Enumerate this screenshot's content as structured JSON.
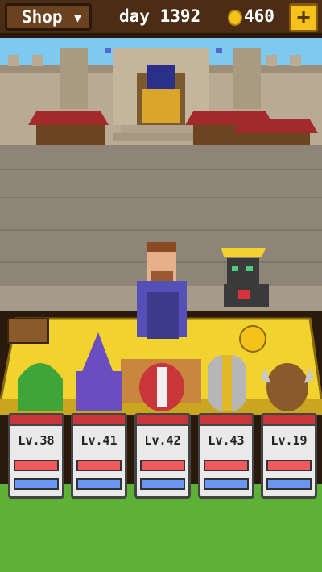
{
  "topbar": {
    "shop_label": "Shop",
    "day_label": "day 1392",
    "gold": "460",
    "add_label": "+"
  },
  "colors": {
    "accent_gold": "#f4c21b",
    "hp_red": "#d8323a",
    "mp_blue": "#3e6fe0",
    "grass": "#5cb136",
    "table_yellow": "#f2d22e"
  },
  "heroes": [
    {
      "name": "green-hooded-hero",
      "level": "Lv.38",
      "hp": 1.0,
      "mp": 1.0
    },
    {
      "name": "purple-wizard-hero",
      "level": "Lv.41",
      "hp": 1.0,
      "mp": 1.0
    },
    {
      "name": "red-helmet-hero",
      "level": "Lv.42",
      "hp": 1.0,
      "mp": 1.0
    },
    {
      "name": "silver-knight-hero",
      "level": "Lv.43",
      "hp": 1.0,
      "mp": 1.0
    },
    {
      "name": "horned-helmet-hero",
      "level": "Lv.19",
      "hp": 1.0,
      "mp": 1.0
    }
  ]
}
